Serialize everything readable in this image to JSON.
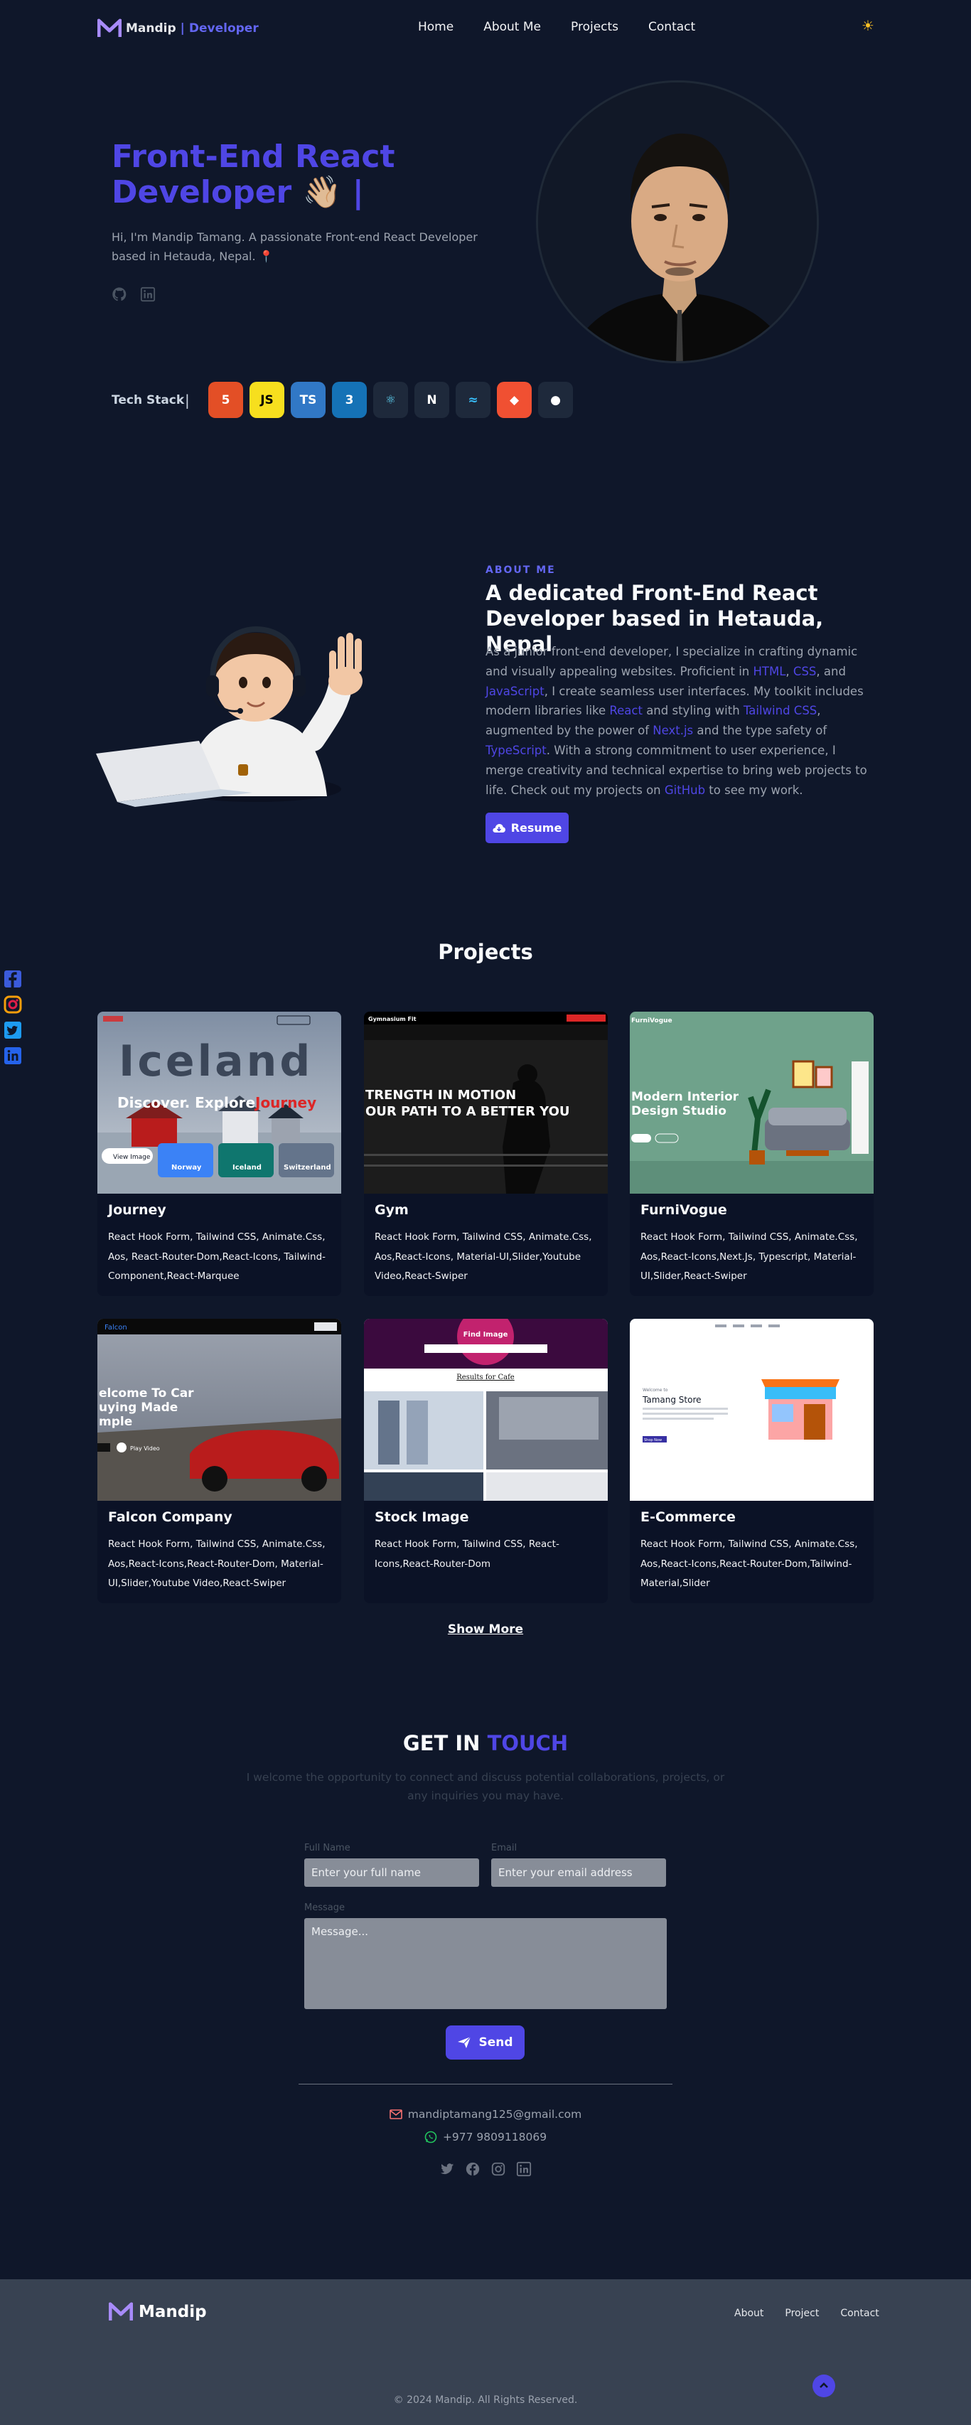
{
  "nav": {
    "logo_name": "Mandip",
    "logo_sep": "|",
    "logo_suffix": "Developer",
    "links": [
      "Home",
      "About Me",
      "Projects",
      "Contact"
    ],
    "theme_icon": "sun-icon"
  },
  "hero": {
    "title_line1": "Front-End React",
    "title_line2": "Developer",
    "wave": "👋🏼",
    "cursor": "|",
    "description": "Hi, I'm Mandip Tamang. A passionate Front-end React Developer based in Hetauda, Nepal.",
    "pin": "📍",
    "social_icons": [
      "github-icon",
      "linkedin-icon"
    ]
  },
  "tech_stack": {
    "label": "Tech Stack",
    "sep": "|",
    "items": [
      {
        "name": "html5-icon",
        "glyph": "5",
        "bg": "#e34f26",
        "fg": "#ffffff"
      },
      {
        "name": "javascript-icon",
        "glyph": "JS",
        "bg": "#f7df1e",
        "fg": "#000000"
      },
      {
        "name": "typescript-icon",
        "glyph": "TS",
        "bg": "#3178c6",
        "fg": "#ffffff"
      },
      {
        "name": "css3-icon",
        "glyph": "3",
        "bg": "#1572b6",
        "fg": "#ffffff"
      },
      {
        "name": "react-icon",
        "glyph": "⚛",
        "bg": "#1e293b",
        "fg": "#61dafb"
      },
      {
        "name": "nextjs-icon",
        "glyph": "N",
        "bg": "#1e293b",
        "fg": "#ffffff"
      },
      {
        "name": "tailwind-icon",
        "glyph": "≈",
        "bg": "#1e293b",
        "fg": "#38bdf8"
      },
      {
        "name": "git-icon",
        "glyph": "◆",
        "bg": "#f05032",
        "fg": "#ffffff"
      },
      {
        "name": "github-icon",
        "glyph": "●",
        "bg": "#1e293b",
        "fg": "#ffffff"
      }
    ]
  },
  "about": {
    "kicker": "ABOUT ME",
    "title": "A dedicated Front-End React Developer based in Hetauda, Nepal",
    "p1": "As a junior front-end developer, I specialize in crafting dynamic and visually appealing websites. Proficient in ",
    "html": "HTML",
    "comma1": ", ",
    "css": "CSS",
    "and1": ", and ",
    "js": "JavaScript",
    "p2": ", I create seamless user interfaces. My toolkit includes modern libraries like ",
    "react": "React",
    "p3": " and styling with ",
    "tailwind": "Tailwind CSS",
    "p4": ", augmented by the power of ",
    "next": "Next.js",
    "p5": " and the type safety of ",
    "ts": "TypeScript",
    "p6": ". With a strong commitment to user experience, I merge creativity and technical expertise to bring web projects to life. Check out my projects on ",
    "github": "GitHub",
    "p7": " to see my work.",
    "resume_label": "Resume"
  },
  "side_social": [
    "facebook-icon",
    "instagram-icon",
    "twitter-icon",
    "linkedin-icon"
  ],
  "projects": {
    "title": "Projects",
    "items": [
      {
        "title": "Journey",
        "desc": "React Hook Form, Tailwind CSS, Animate.Css, Aos, React-Router-Dom,React-Icons, Tailwind-Component,React-Marquee",
        "thumb": {
          "headline": "Iceland",
          "tagline1": "Discover. Explore.",
          "tagline2": "Journey",
          "btn": "View Image",
          "chips": [
            "Norway",
            "Iceland",
            "Switzerland"
          ]
        }
      },
      {
        "title": "Gym",
        "desc": "React Hook Form, Tailwind CSS, Animate.Css, Aos,React-Icons, Material-UI,Slider,Youtube Video,React-Swiper",
        "thumb": {
          "brand": "Gymnasium Fit",
          "line1": "TRENGTH IN MOTION",
          "line2": "OUR PATH TO A BETTER YOU"
        }
      },
      {
        "title": "FurniVogue",
        "desc": "React Hook Form, Tailwind CSS, Animate.Css, Aos,React-Icons,Next.Js, Typescript, Material-UI,Slider,React-Swiper",
        "thumb": {
          "brand": "FurniVogue",
          "line1": "Modern Interior",
          "line2": "Design Studio"
        }
      },
      {
        "title": "Falcon Company",
        "desc": "React Hook Form, Tailwind CSS, Animate.Css, Aos,React-Icons,React-Router-Dom, Material-UI,Slider,Youtube Video,React-Swiper",
        "thumb": {
          "brand": "Falcon",
          "line1": "elcome To Car",
          "line2": "uying Made",
          "line3": "mple",
          "btn": "Play Video"
        }
      },
      {
        "title": "Stock Image",
        "desc": "React Hook Form, Tailwind CSS, React-Icons,React-Router-Dom",
        "thumb": {
          "banner": "Find Image",
          "sub": "Results for Cafe"
        }
      },
      {
        "title": "E-Commerce",
        "desc": "React Hook Form, Tailwind CSS, Animate.Css, Aos,React-Icons,React-Router-Dom,Tailwind-Material,Slider",
        "thumb": {
          "kicker": "Welcome to",
          "name": "Tamang Store",
          "btn": "Shop Now"
        }
      }
    ],
    "show_more": "Show More"
  },
  "contact": {
    "title_a": "GET IN",
    "title_b": "TOUCH",
    "subtitle": "I welcome the opportunity to connect and discuss potential collaborations, projects, or any inquiries you may have.",
    "name_label": "Full Name",
    "name_placeholder": "Enter your full name",
    "email_label": "Email",
    "email_placeholder": "Enter your email address",
    "message_label": "Message",
    "message_placeholder": "Message...",
    "send_label": "Send",
    "email": "mandiptamang125@gmail.com",
    "phone": "+977 9809118069",
    "social": [
      "twitter-icon",
      "facebook-icon",
      "instagram-icon",
      "linkedin-icon"
    ]
  },
  "footer": {
    "logo_name": "Mandip",
    "links": [
      "About",
      "Project",
      "Contact"
    ],
    "copyright": "© 2024 Mandip. All Rights Reserved."
  },
  "colors": {
    "background": "#0f172a",
    "accent": "#4f46e5",
    "footer": "#384252"
  }
}
